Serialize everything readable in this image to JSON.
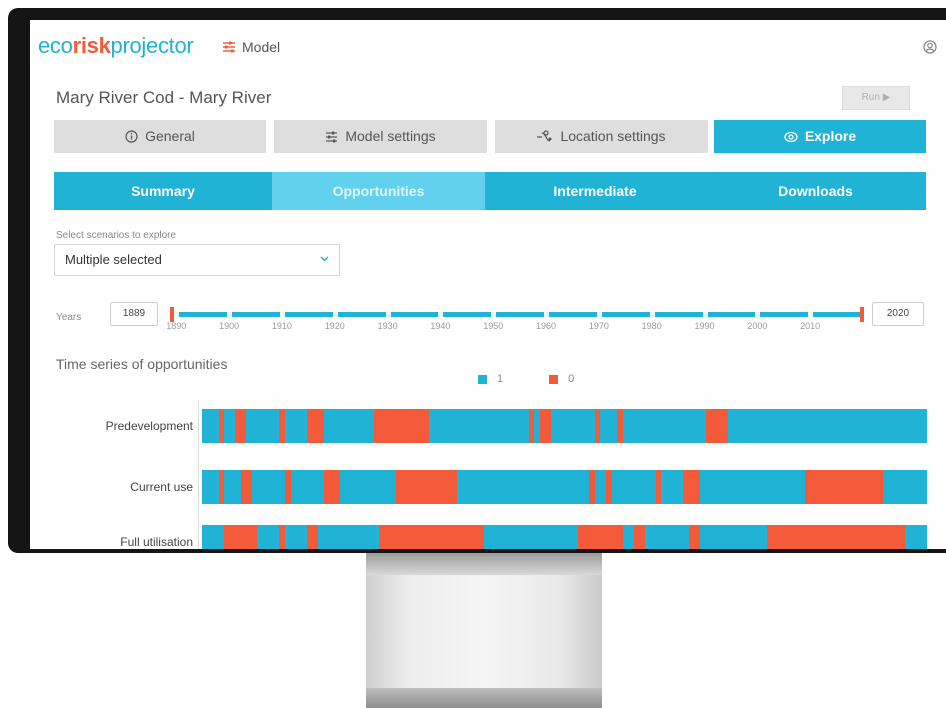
{
  "header": {
    "logo": {
      "part1": "eco",
      "part2": "risk",
      "part3": "projector"
    },
    "model_link": "Model",
    "icons": {
      "model": "sliders-icon",
      "user": "user-icon"
    }
  },
  "page": {
    "title": "Mary River Cod - Mary River",
    "run_button": "Run ▶"
  },
  "main_tabs": [
    {
      "label": "General",
      "icon": "info-icon",
      "active": false
    },
    {
      "label": "Model settings",
      "icon": "sliders-icon",
      "active": false
    },
    {
      "label": "Location settings",
      "icon": "location-icon",
      "active": false
    },
    {
      "label": "Explore",
      "icon": "eye-icon",
      "active": true
    }
  ],
  "sub_tabs": [
    {
      "label": "Summary",
      "active": false
    },
    {
      "label": "Opportunities",
      "active": true
    },
    {
      "label": "Intermediate",
      "active": false
    },
    {
      "label": "Downloads",
      "active": false
    }
  ],
  "scenario_select": {
    "label": "Select scenarios to explore",
    "value": "Multiple selected"
  },
  "years": {
    "label": "Years",
    "from": "1889",
    "to": "2020",
    "ticks": [
      "1890",
      "1900",
      "1910",
      "1920",
      "1930",
      "1940",
      "1950",
      "1960",
      "1970",
      "1980",
      "1990",
      "2000",
      "2010"
    ]
  },
  "colors": {
    "accent": "#21b3d6",
    "alert": "#f25a3a"
  },
  "chart_data": {
    "type": "heatmap",
    "title": "Time series of opportunities",
    "legend": [
      {
        "name": "1",
        "color": "#21b3d6"
      },
      {
        "name": "0",
        "color": "#f25a3a"
      }
    ],
    "x_range": [
      1889,
      2020
    ],
    "rows": [
      {
        "name": "Predevelopment",
        "zero_periods": [
          [
            1892,
            1893
          ],
          [
            1895,
            1897
          ],
          [
            1903,
            1904
          ],
          [
            1908,
            1911
          ],
          [
            1920,
            1930
          ],
          [
            1948,
            1949
          ],
          [
            1950,
            1952
          ],
          [
            1960,
            1961
          ],
          [
            1964,
            1965
          ],
          [
            1980,
            1984
          ]
        ]
      },
      {
        "name": "Current use",
        "zero_periods": [
          [
            1892,
            1893
          ],
          [
            1896,
            1898
          ],
          [
            1904,
            1905
          ],
          [
            1911,
            1914
          ],
          [
            1924,
            1935
          ],
          [
            1959,
            1960
          ],
          [
            1962,
            1963
          ],
          [
            1971,
            1972
          ],
          [
            1976,
            1979
          ],
          [
            1998,
            2012
          ]
        ]
      },
      {
        "name": "Full utilisation",
        "zero_periods": [
          [
            1893,
            1899
          ],
          [
            1903,
            1904
          ],
          [
            1908,
            1910
          ],
          [
            1921,
            1940
          ],
          [
            1957,
            1965
          ],
          [
            1967,
            1969
          ],
          [
            1977,
            1979
          ],
          [
            1991,
            2016
          ]
        ]
      }
    ]
  }
}
